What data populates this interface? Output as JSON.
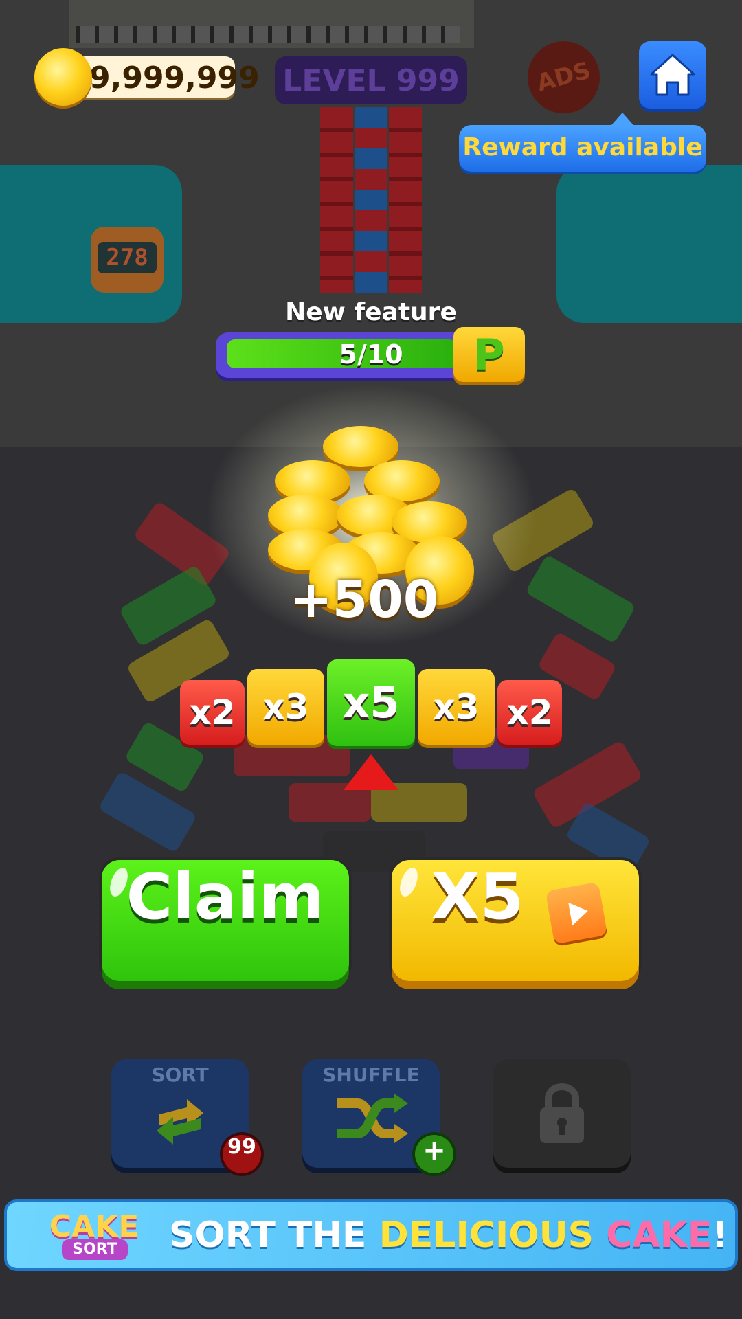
{
  "hud": {
    "coins": "9,999,999",
    "level": "LEVEL 999",
    "ads_badge": "ADS",
    "reward_tip": "Reward available",
    "parking_counter": "278"
  },
  "feature": {
    "title": "New feature",
    "progress_text": "5/10",
    "progress": 0.5,
    "icon_letter": "P"
  },
  "reward": {
    "amount": "+500",
    "multipliers": [
      "x2",
      "x3",
      "x5",
      "x3",
      "x2"
    ],
    "selected_multiplier": "x5"
  },
  "buttons": {
    "claim": "Claim",
    "multiply": "X5"
  },
  "boosters": {
    "sort_label": "SORT",
    "sort_count": "99",
    "shuffle_label": "SHUFFLE",
    "shuffle_badge": "+"
  },
  "banner": {
    "logo_top": "CAKE",
    "logo_bottom": "SORT",
    "text_part1": "SORT THE ",
    "text_part2": "DELICIOUS ",
    "text_part3": "CAKE",
    "text_part4": "!"
  },
  "colors": {
    "accent_green": "#2fc40c",
    "accent_yellow": "#f2b800",
    "accent_red": "#d61e1e",
    "accent_blue": "#1b5ee0"
  }
}
